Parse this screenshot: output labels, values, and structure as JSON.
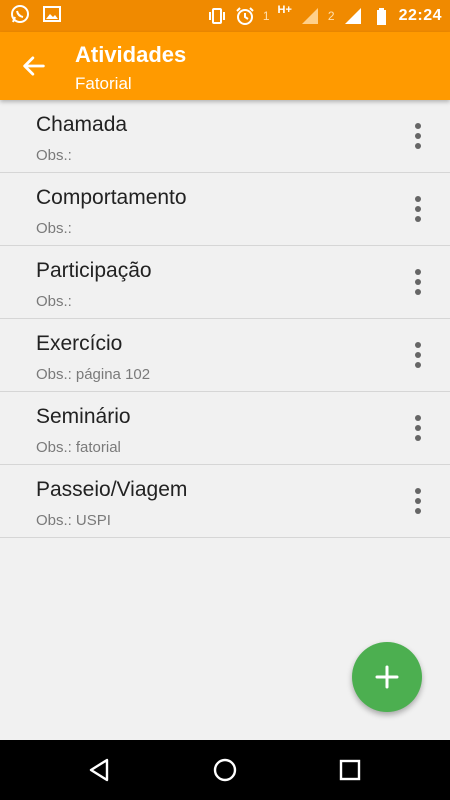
{
  "status_bar": {
    "time": "22:24",
    "sim1_label": "1",
    "sim1_network": "H+",
    "sim2_label": "2",
    "icons": [
      "whatsapp-icon",
      "image-icon",
      "vibrate-icon",
      "alarm-icon",
      "signal-icon",
      "battery-icon"
    ]
  },
  "appbar": {
    "title": "Atividades",
    "subtitle": "Fatorial",
    "color": "#ff9a00"
  },
  "list": {
    "obs_prefix": "Obs.:",
    "items": [
      {
        "name": "Chamada",
        "obs": ""
      },
      {
        "name": "Comportamento",
        "obs": ""
      },
      {
        "name": "Participação",
        "obs": ""
      },
      {
        "name": "Exercício",
        "obs": "página 102"
      },
      {
        "name": "Seminário",
        "obs": "fatorial"
      },
      {
        "name": "Passeio/Viagem",
        "obs": "USPI"
      }
    ]
  },
  "fab": {
    "icon": "add-icon",
    "color": "#4caf50"
  },
  "navbar": {
    "icons": [
      "back-triangle-icon",
      "home-circle-icon",
      "recents-square-icon"
    ]
  }
}
